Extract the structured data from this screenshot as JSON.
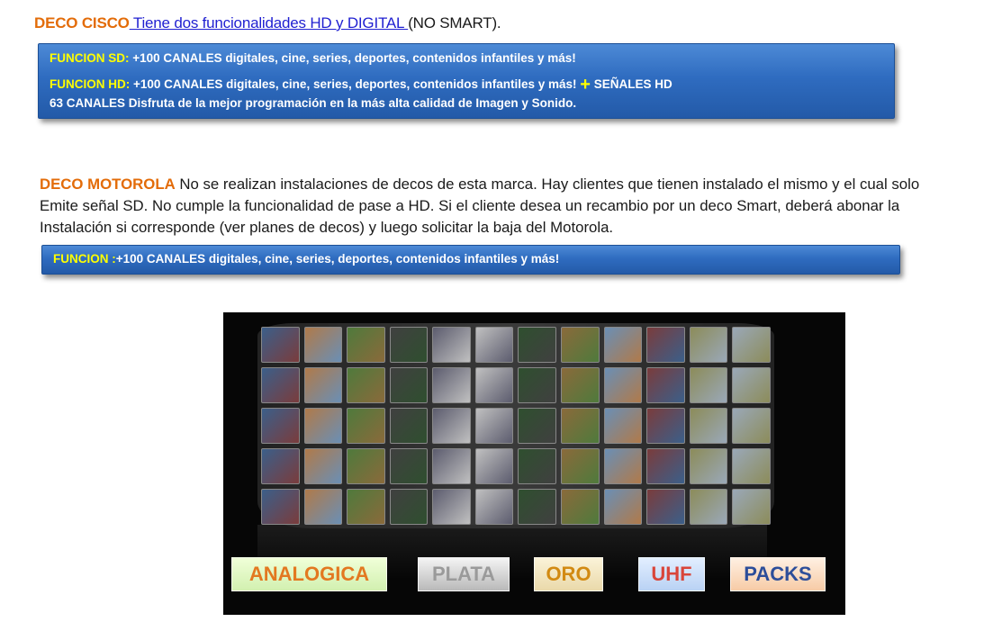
{
  "cisco": {
    "title": "DECO CISCO",
    "link_text": " Tiene dos funcionalidades HD y DIGITAL ",
    "suffix": "(NO SMART).",
    "box": {
      "sd_label": "FUNCION SD:",
      "sd_text": " +100 CANALES digitales, cine, series, deportes, contenidos infantiles y más!",
      "hd_label": "FUNCION HD:",
      "hd_text": " +100 CANALES digitales, cine, series, deportes, contenidos infantiles y más! ",
      "plus": "+",
      "hd_signals": " SEÑALES HD",
      "hd_detail": "63 CANALES Disfruta de la mejor programación en la más alta calidad de Imagen y Sonido."
    }
  },
  "motorola": {
    "title": "DECO MOTOROLA",
    "line1": " No se realizan instalaciones de decos de esta marca. Hay clientes que tienen instalado el mismo y el cual solo",
    "line2": "Emite señal SD. No cumple la funcionalidad de pase a HD. Si el cliente desea un recambio por un deco Smart, deberá abonar la",
    "line3": "Instalación si corresponde (ver planes de decos) y luego solicitar la baja del Motorola.",
    "box": {
      "label": "FUNCION :",
      "text": "+100 CANALES digitales, cine, series, deportes, contenidos infantiles y más!"
    }
  },
  "plans": {
    "analogica": "ANALOGICA",
    "plata": "PLATA",
    "oro": "ORO",
    "uhf": "UHF",
    "packs": "PACKS"
  },
  "colors": {
    "heading_orange": "#e36c09",
    "box_blue": "#2f6cc0",
    "box_label_yellow": "#ffff00",
    "link_blue": "#1f1fd1"
  }
}
